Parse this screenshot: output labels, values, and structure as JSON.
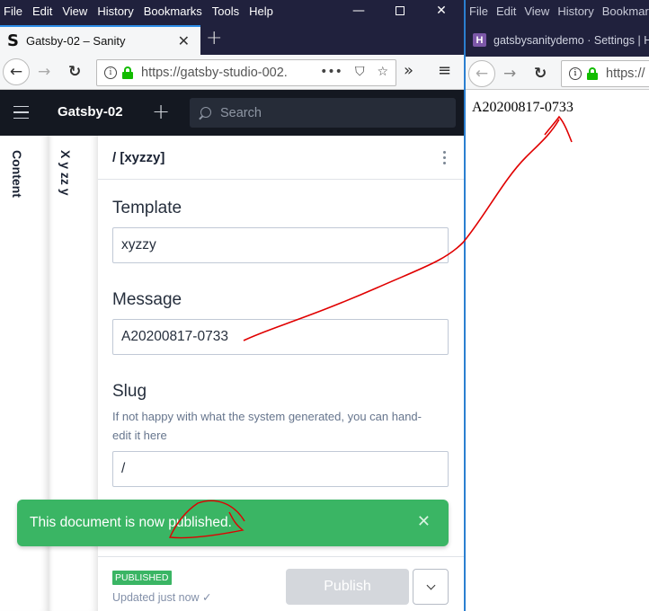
{
  "left_window": {
    "menu": [
      "File",
      "Edit",
      "View",
      "History",
      "Bookmarks",
      "Tools",
      "Help"
    ],
    "window_controls": [
      "minimize",
      "maximize",
      "close"
    ],
    "tab": {
      "favicon": "S",
      "title": "Gatsby-02 – Sanity"
    },
    "url": "https://gatsby-studio-002.",
    "studio": {
      "brand": "Gatsby-02",
      "search_placeholder": "Search",
      "pane1_title": "Content",
      "pane2_title": "X y zz y",
      "doc_title": "/ [xyzzy]",
      "fields": {
        "template": {
          "label": "Template",
          "value": "xyzzy"
        },
        "message": {
          "label": "Message",
          "value": "A20200817-0733"
        },
        "slug": {
          "label": "Slug",
          "description": "If not happy with what the system generated, you can hand-edit it here",
          "value": "/"
        }
      },
      "toast": {
        "message": "This document is now published.",
        "color": "#3ab564"
      },
      "footer": {
        "status_badge": "PUBLISHED",
        "updated": "Updated just now ✓",
        "publish_label": "Publish"
      }
    }
  },
  "right_window": {
    "menu": [
      "File",
      "Edit",
      "View",
      "History",
      "Bookmark"
    ],
    "tab": {
      "favicon": "H",
      "title": "gatsbysanitydemo · Settings | H"
    },
    "url": "https://",
    "page_text": "A20200817-0733"
  },
  "annotation_color": "#e00000"
}
